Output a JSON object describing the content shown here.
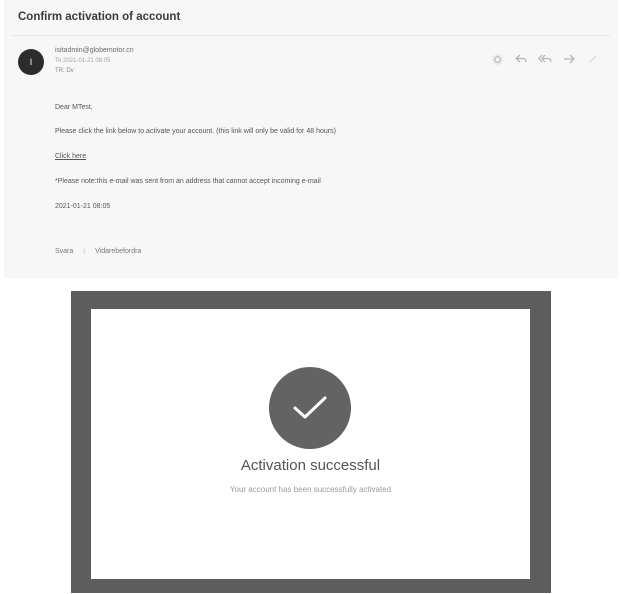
{
  "email": {
    "subject": "Confirm activation of account",
    "avatar_initial": "I",
    "sender_email": "isitadmin@globemotor.cn",
    "sender_date": "To 2021-01-21 08:05",
    "recipient": "TR: Dv",
    "toolbar_icons": [
      "settings-icon",
      "reply-icon",
      "reply-all-icon",
      "forward-icon",
      "more-icon"
    ],
    "greeting": "Dear MTest,",
    "instruction": "Please click the link below to activate your account. (this link will only be valid for 48 hours)",
    "link_label": "Click here",
    "notice": "*Please note:this e-mail was sent from an address that cannot accept incoming e-mail",
    "timestamp": "2021-01-21 08:05",
    "footer_left": "Svara",
    "footer_right": "Vidarebefordra"
  },
  "activation": {
    "title": "Activation successful",
    "subtitle": "Your account has been successfully activated"
  }
}
